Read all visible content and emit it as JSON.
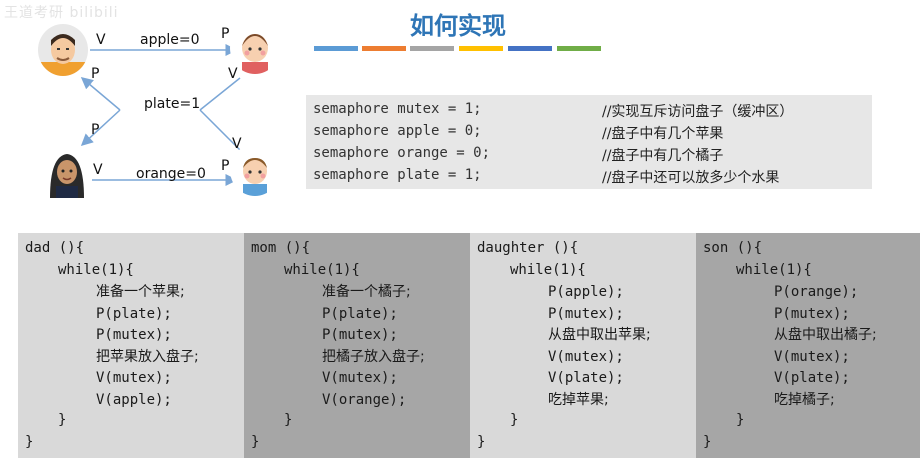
{
  "watermark": "王道考研 bilibili",
  "title": "如何实现",
  "colors": {
    "bars": [
      "#5b9bd5",
      "#ed7d31",
      "#a5a5a5",
      "#ffc000",
      "#4472c4",
      "#70ad47"
    ],
    "panel_light": "#d9d9d9",
    "panel_dark": "#a6a6a6",
    "arrow": "#7aa6d6"
  },
  "diagram": {
    "apple_label": "apple=0",
    "orange_label": "orange=0",
    "plate_label": "plate=1",
    "v": "V",
    "p": "P",
    "avatars": [
      {
        "name": "dad",
        "icon": "dad-avatar-icon"
      },
      {
        "name": "daughter",
        "icon": "daughter-avatar-icon"
      },
      {
        "name": "mom",
        "icon": "mom-avatar-icon"
      },
      {
        "name": "son",
        "icon": "son-avatar-icon"
      }
    ]
  },
  "semaphores": [
    {
      "code": "semaphore mutex = 1;",
      "comment": "//实现互斥访问盘子（缓冲区）"
    },
    {
      "code": "semaphore apple = 0;",
      "comment": "//盘子中有几个苹果"
    },
    {
      "code": "semaphore orange = 0;",
      "comment": "//盘子中有几个橘子"
    },
    {
      "code": "semaphore plate = 1;",
      "comment": "//盘子中还可以放多少个水果"
    }
  ],
  "panels": [
    {
      "name": "dad",
      "header": "dad (){",
      "loop": "while(1){",
      "body": [
        "准备一个苹果;",
        "P(plate);",
        "P(mutex);",
        "把苹果放入盘子;",
        "V(mutex);",
        "V(apple);"
      ],
      "close_inner": "}",
      "close_outer": "}"
    },
    {
      "name": "mom",
      "header": "mom (){",
      "loop": "while(1){",
      "body": [
        "准备一个橘子;",
        "P(plate);",
        "P(mutex);",
        "把橘子放入盘子;",
        "V(mutex);",
        "V(orange);"
      ],
      "close_inner": "}",
      "close_outer": "}"
    },
    {
      "name": "daughter",
      "header": "daughter (){",
      "loop": "while(1){",
      "body": [
        "P(apple);",
        "P(mutex);",
        "从盘中取出苹果;",
        "V(mutex);",
        "V(plate);",
        "吃掉苹果;"
      ],
      "close_inner": "}",
      "close_outer": "}"
    },
    {
      "name": "son",
      "header": "son (){",
      "loop": "while(1){",
      "body": [
        "P(orange);",
        "P(mutex);",
        "从盘中取出橘子;",
        "V(mutex);",
        "V(plate);",
        "吃掉橘子;"
      ],
      "close_inner": "}",
      "close_outer": "}"
    }
  ]
}
